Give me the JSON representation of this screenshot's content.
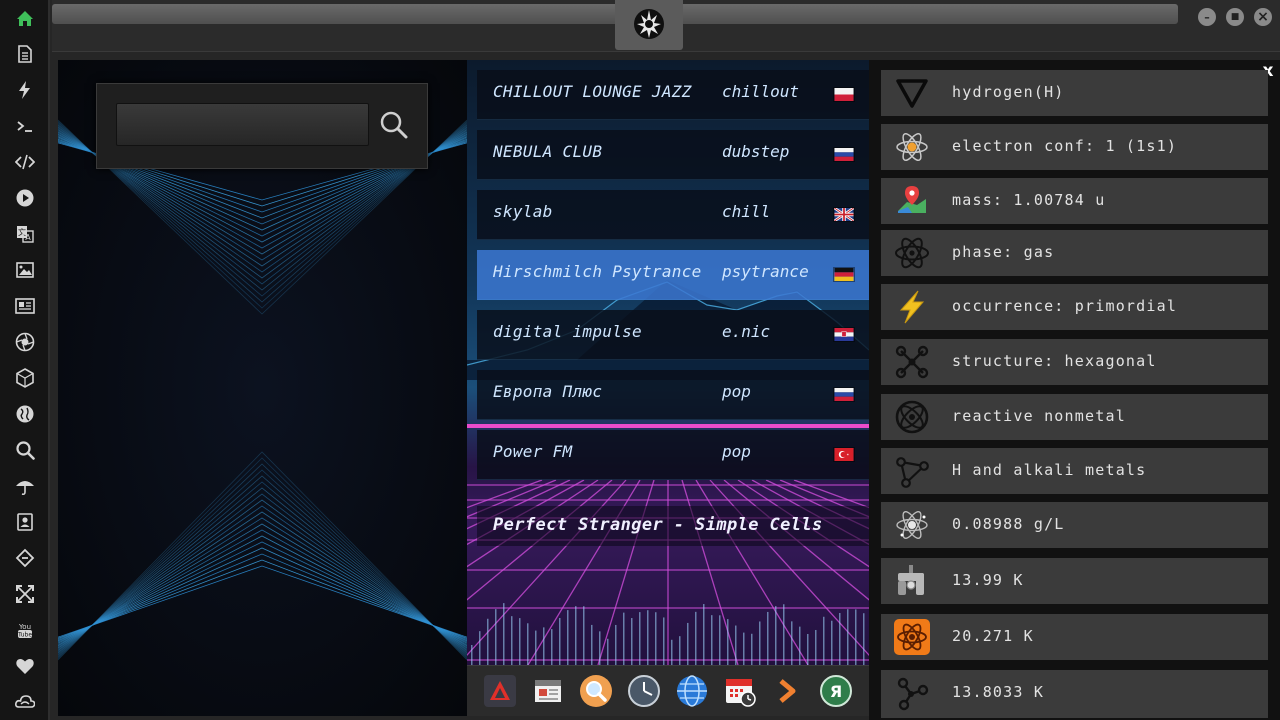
{
  "sidebar": {
    "items": [
      {
        "icon": "home-icon"
      },
      {
        "icon": "document-icon"
      },
      {
        "icon": "bolt-icon"
      },
      {
        "icon": "terminal-icon"
      },
      {
        "icon": "code-icon"
      },
      {
        "icon": "play-icon"
      },
      {
        "icon": "translate-icon"
      },
      {
        "icon": "image-icon"
      },
      {
        "icon": "news-icon"
      },
      {
        "icon": "aperture-icon"
      },
      {
        "icon": "hexagon-icon"
      },
      {
        "icon": "globe-icon"
      },
      {
        "icon": "search-icon"
      },
      {
        "icon": "umbrella-icon"
      },
      {
        "icon": "contacts-icon"
      },
      {
        "icon": "link-icon"
      },
      {
        "icon": "expand-icon"
      },
      {
        "icon": "youtube-icon"
      },
      {
        "icon": "heart-icon"
      },
      {
        "icon": "cloud-icon"
      }
    ]
  },
  "titlebar": {
    "logo": "rebel-alliance-icon",
    "minimize": "–",
    "maximize": "■",
    "close": "×"
  },
  "search": {
    "value": "",
    "placeholder": ""
  },
  "stations": [
    {
      "name": "CHILLOUT LOUNGE JAZZ",
      "genre": "chillout",
      "flag": "PL"
    },
    {
      "name": "NEBULA CLUB",
      "genre": "dubstep",
      "flag": "RU"
    },
    {
      "name": "skylab",
      "genre": "chill",
      "flag": "GB"
    },
    {
      "name": "Hirschmilch Psytrance",
      "genre": "psytrance",
      "flag": "DE"
    },
    {
      "name": "digital impulse",
      "genre": "e.nic",
      "flag": "HR"
    },
    {
      "name": "Европа Плюс",
      "genre": "pop",
      "flag": "RU"
    },
    {
      "name": "Power FM",
      "genre": "pop",
      "flag": "TR"
    }
  ],
  "active_station_index": 3,
  "now_playing": "Perfect Stranger - Simple Cells",
  "dock": {
    "items": [
      "app-launcher-icon",
      "calendar-sheet-icon",
      "magnifier-icon",
      "clock-icon",
      "globe-icon",
      "calendar-clock-icon",
      "chevron-right-icon",
      "yandex-icon"
    ]
  },
  "element": {
    "close": "x",
    "properties": [
      {
        "icon": "triangle-icon",
        "text": "hydrogen(H)"
      },
      {
        "icon": "atom-glow-icon",
        "text": "electron conf: 1 (1s1)"
      },
      {
        "icon": "map-pin-icon",
        "text": "mass: 1.00784 u"
      },
      {
        "icon": "atom-icon",
        "text": "phase: gas"
      },
      {
        "icon": "lightning-icon",
        "text": "occurrence: primordial"
      },
      {
        "icon": "molecule-icon",
        "text": "structure: hexagonal"
      },
      {
        "icon": "orbit-icon",
        "text": "reactive nonmetal"
      },
      {
        "icon": "graph-icon",
        "text": "H and alkali metals"
      },
      {
        "icon": "atom-sparkle-icon",
        "text": "0.08988 g/L"
      },
      {
        "icon": "pipe-icon",
        "text": "13.99 K"
      },
      {
        "icon": "atom-orange-icon",
        "text": "20.271 K"
      },
      {
        "icon": "nodes-icon",
        "text": "13.8033 K"
      }
    ]
  },
  "colors": {
    "sidebar_active": "#3fbf5a",
    "sidebar_icon": "#d6d6d6",
    "active_station": "#3c78d2",
    "text_light": "#e2e2e2",
    "neon_pink": "#ff3fd8",
    "neon_cyan": "#3fd0ff"
  }
}
